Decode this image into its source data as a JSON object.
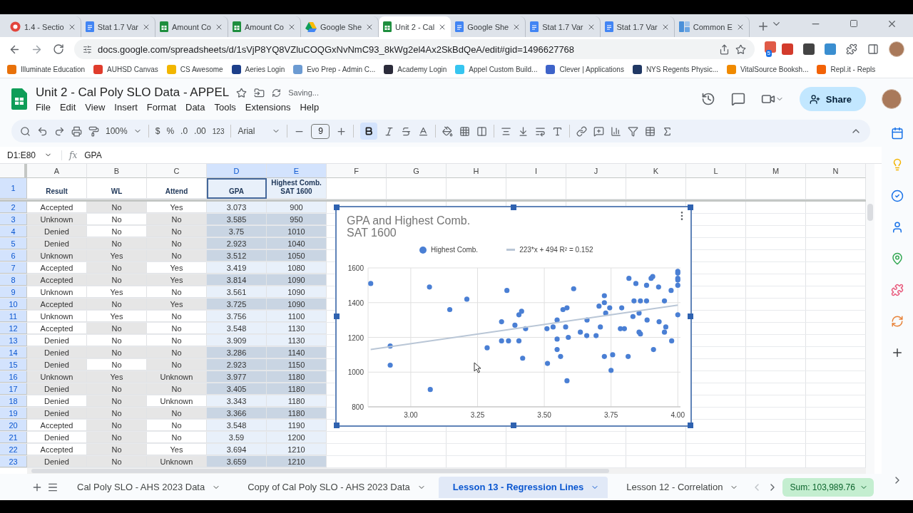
{
  "browser": {
    "tabs": [
      {
        "label": "1.4 - Sectio",
        "kind": "section",
        "selected": false
      },
      {
        "label": "Stat 1.7 Var",
        "kind": "docs",
        "selected": false
      },
      {
        "label": "Amount Co",
        "kind": "sheets",
        "selected": false
      },
      {
        "label": "Amount Co",
        "kind": "sheets",
        "selected": false
      },
      {
        "label": "Google She",
        "kind": "drive",
        "selected": false
      },
      {
        "label": "Unit 2 - Cal",
        "kind": "sheets",
        "selected": true
      },
      {
        "label": "Google She",
        "kind": "docs",
        "selected": false
      },
      {
        "label": "Stat 1.7 Var",
        "kind": "docs",
        "selected": false
      },
      {
        "label": "Stat 1.7 Var",
        "kind": "docs",
        "selected": false
      },
      {
        "label": "Common E",
        "kind": "app",
        "selected": false
      }
    ],
    "url": "docs.google.com/spreadsheets/d/1sVjP8YQ8VZluCOQGxNvNmC93_8kWg2el4Ax2SkBdQeA/edit#gid=1496627768",
    "extension_badge": "5"
  },
  "bookmarks": [
    {
      "label": "Illuminate Education",
      "color": "#e8710a"
    },
    {
      "label": "AUHSD Canvas",
      "color": "#e03c2c"
    },
    {
      "label": "CS Awesome",
      "color": "#f2b600"
    },
    {
      "label": "Aeries Login",
      "color": "#1d3f8a"
    },
    {
      "label": "Evo Prep - Admin C...",
      "color": "#6c9bd2"
    },
    {
      "label": "Academy Login",
      "color": "#2b2b3a"
    },
    {
      "label": "Appel Custom Build...",
      "color": "#36c5f0"
    },
    {
      "label": "Clever | Applications",
      "color": "#3e63c9"
    },
    {
      "label": "NYS Regents Physic...",
      "color": "#203864"
    },
    {
      "label": "VitalSource Booksh...",
      "color": "#f08a00"
    },
    {
      "label": "Repl.it - Repls",
      "color": "#f26207"
    }
  ],
  "document": {
    "title": "Unit 2 - Cal Poly SLO Data - APPEL",
    "status": "Saving...",
    "menu": [
      "File",
      "Edit",
      "View",
      "Insert",
      "Format",
      "Data",
      "Tools",
      "Extensions",
      "Help"
    ],
    "share": "Share"
  },
  "toolbar": {
    "zoom": "100%",
    "currency": "$",
    "percent": "%",
    "decrease_decimal": ".0",
    "increase_decimal": ".00",
    "number_format": "123",
    "font": "Arial",
    "font_size": "9",
    "bold_on": true
  },
  "formula_bar": {
    "name_box": "D1:E80",
    "fx": "fx",
    "formula": "GPA"
  },
  "sheet": {
    "columns": [
      {
        "label": "A",
        "selected": false
      },
      {
        "label": "B",
        "selected": false
      },
      {
        "label": "C",
        "selected": false
      },
      {
        "label": "D",
        "selected": true
      },
      {
        "label": "E",
        "selected": true
      },
      {
        "label": "F",
        "selected": false
      },
      {
        "label": "G",
        "selected": false
      },
      {
        "label": "H",
        "selected": false
      },
      {
        "label": "I",
        "selected": false
      },
      {
        "label": "J",
        "selected": false
      },
      {
        "label": "K",
        "selected": false
      },
      {
        "label": "L",
        "selected": false
      },
      {
        "label": "M",
        "selected": false
      },
      {
        "label": "N",
        "selected": false
      }
    ],
    "rows": [
      {
        "number": "1",
        "selected": true,
        "cells": [
          {
            "text": "Result",
            "shaded": false,
            "active": false
          },
          {
            "text": "WL",
            "shaded": false,
            "active": false
          },
          {
            "text": "Attend",
            "shaded": false,
            "active": false
          },
          {
            "text": "GPA",
            "shaded": false,
            "active": true
          },
          {
            "text": "Highest Comb. SAT 1600",
            "shaded": false,
            "active": false
          }
        ]
      },
      {
        "number": "2",
        "selected": true,
        "cells": [
          {
            "text": "Accepted",
            "shaded": false
          },
          {
            "text": "No",
            "shaded": true
          },
          {
            "text": "Yes",
            "shaded": false
          },
          {
            "text": "3.073",
            "shaded": false
          },
          {
            "text": "900",
            "shaded": false
          }
        ]
      },
      {
        "number": "3",
        "selected": true,
        "cells": [
          {
            "text": "Unknown",
            "shaded": true
          },
          {
            "text": "No",
            "shaded": false
          },
          {
            "text": "No",
            "shaded": true
          },
          {
            "text": "3.585",
            "shaded": true
          },
          {
            "text": "950",
            "shaded": true
          }
        ]
      },
      {
        "number": "4",
        "selected": true,
        "cells": [
          {
            "text": "Denied",
            "shaded": true
          },
          {
            "text": "No",
            "shaded": false
          },
          {
            "text": "No",
            "shaded": true
          },
          {
            "text": "3.75",
            "shaded": true
          },
          {
            "text": "1010",
            "shaded": true
          }
        ]
      },
      {
        "number": "5",
        "selected": true,
        "cells": [
          {
            "text": "Denied",
            "shaded": true
          },
          {
            "text": "No",
            "shaded": true
          },
          {
            "text": "No",
            "shaded": true
          },
          {
            "text": "2.923",
            "shaded": true
          },
          {
            "text": "1040",
            "shaded": true
          }
        ]
      },
      {
        "number": "6",
        "selected": true,
        "cells": [
          {
            "text": "Unknown",
            "shaded": true
          },
          {
            "text": "Yes",
            "shaded": true
          },
          {
            "text": "No",
            "shaded": true
          },
          {
            "text": "3.512",
            "shaded": true
          },
          {
            "text": "1050",
            "shaded": true
          }
        ]
      },
      {
        "number": "7",
        "selected": true,
        "cells": [
          {
            "text": "Accepted",
            "shaded": false
          },
          {
            "text": "No",
            "shaded": true
          },
          {
            "text": "Yes",
            "shaded": false
          },
          {
            "text": "3.419",
            "shaded": false
          },
          {
            "text": "1080",
            "shaded": false
          }
        ]
      },
      {
        "number": "8",
        "selected": true,
        "cells": [
          {
            "text": "Accepted",
            "shaded": true
          },
          {
            "text": "No",
            "shaded": true
          },
          {
            "text": "Yes",
            "shaded": true
          },
          {
            "text": "3.814",
            "shaded": true
          },
          {
            "text": "1090",
            "shaded": true
          }
        ]
      },
      {
        "number": "9",
        "selected": true,
        "cells": [
          {
            "text": "Unknown",
            "shaded": false
          },
          {
            "text": "Yes",
            "shaded": false
          },
          {
            "text": "No",
            "shaded": false
          },
          {
            "text": "3.561",
            "shaded": false
          },
          {
            "text": "1090",
            "shaded": false
          }
        ]
      },
      {
        "number": "10",
        "selected": true,
        "cells": [
          {
            "text": "Accepted",
            "shaded": true
          },
          {
            "text": "No",
            "shaded": true
          },
          {
            "text": "Yes",
            "shaded": true
          },
          {
            "text": "3.725",
            "shaded": true
          },
          {
            "text": "1090",
            "shaded": true
          }
        ]
      },
      {
        "number": "11",
        "selected": true,
        "cells": [
          {
            "text": "Unknown",
            "shaded": false
          },
          {
            "text": "Yes",
            "shaded": false
          },
          {
            "text": "No",
            "shaded": false
          },
          {
            "text": "3.756",
            "shaded": false
          },
          {
            "text": "1100",
            "shaded": false
          }
        ]
      },
      {
        "number": "12",
        "selected": true,
        "cells": [
          {
            "text": "Accepted",
            "shaded": false
          },
          {
            "text": "No",
            "shaded": true
          },
          {
            "text": "No",
            "shaded": false
          },
          {
            "text": "3.548",
            "shaded": false
          },
          {
            "text": "1130",
            "shaded": false
          }
        ]
      },
      {
        "number": "13",
        "selected": true,
        "cells": [
          {
            "text": "Denied",
            "shaded": false
          },
          {
            "text": "No",
            "shaded": false
          },
          {
            "text": "No",
            "shaded": false
          },
          {
            "text": "3.909",
            "shaded": false
          },
          {
            "text": "1130",
            "shaded": false
          }
        ]
      },
      {
        "number": "14",
        "selected": true,
        "cells": [
          {
            "text": "Denied",
            "shaded": true
          },
          {
            "text": "No",
            "shaded": true
          },
          {
            "text": "No",
            "shaded": true
          },
          {
            "text": "3.286",
            "shaded": true
          },
          {
            "text": "1140",
            "shaded": true
          }
        ]
      },
      {
        "number": "15",
        "selected": true,
        "cells": [
          {
            "text": "Denied",
            "shaded": true
          },
          {
            "text": "No",
            "shaded": false
          },
          {
            "text": "No",
            "shaded": true
          },
          {
            "text": "2.923",
            "shaded": true
          },
          {
            "text": "1150",
            "shaded": true
          }
        ]
      },
      {
        "number": "16",
        "selected": true,
        "cells": [
          {
            "text": "Unknown",
            "shaded": true
          },
          {
            "text": "Yes",
            "shaded": true
          },
          {
            "text": "Unknown",
            "shaded": true
          },
          {
            "text": "3.977",
            "shaded": true
          },
          {
            "text": "1180",
            "shaded": true
          }
        ]
      },
      {
        "number": "17",
        "selected": true,
        "cells": [
          {
            "text": "Denied",
            "shaded": true
          },
          {
            "text": "No",
            "shaded": true
          },
          {
            "text": "No",
            "shaded": true
          },
          {
            "text": "3.405",
            "shaded": true
          },
          {
            "text": "1180",
            "shaded": true
          }
        ]
      },
      {
        "number": "18",
        "selected": true,
        "cells": [
          {
            "text": "Denied",
            "shaded": false
          },
          {
            "text": "No",
            "shaded": true
          },
          {
            "text": "Unknown",
            "shaded": false
          },
          {
            "text": "3.343",
            "shaded": false
          },
          {
            "text": "1180",
            "shaded": false
          }
        ]
      },
      {
        "number": "19",
        "selected": true,
        "cells": [
          {
            "text": "Denied",
            "shaded": true
          },
          {
            "text": "No",
            "shaded": true
          },
          {
            "text": "No",
            "shaded": true
          },
          {
            "text": "3.366",
            "shaded": true
          },
          {
            "text": "1180",
            "shaded": true
          }
        ]
      },
      {
        "number": "20",
        "selected": true,
        "cells": [
          {
            "text": "Accepted",
            "shaded": false
          },
          {
            "text": "No",
            "shaded": true
          },
          {
            "text": "No",
            "shaded": false
          },
          {
            "text": "3.548",
            "shaded": false
          },
          {
            "text": "1190",
            "shaded": false
          }
        ]
      },
      {
        "number": "21",
        "selected": true,
        "cells": [
          {
            "text": "Denied",
            "shaded": false
          },
          {
            "text": "No",
            "shaded": true
          },
          {
            "text": "No",
            "shaded": false
          },
          {
            "text": "3.59",
            "shaded": false
          },
          {
            "text": "1200",
            "shaded": false
          }
        ]
      },
      {
        "number": "22",
        "selected": true,
        "cells": [
          {
            "text": "Accepted",
            "shaded": false
          },
          {
            "text": "No",
            "shaded": true
          },
          {
            "text": "Yes",
            "shaded": false
          },
          {
            "text": "3.694",
            "shaded": false
          },
          {
            "text": "1210",
            "shaded": false
          }
        ]
      },
      {
        "number": "23",
        "selected": true,
        "cells": [
          {
            "text": "Denied",
            "shaded": true
          },
          {
            "text": "No",
            "shaded": true
          },
          {
            "text": "Unknown",
            "shaded": true
          },
          {
            "text": "3.659",
            "shaded": true
          },
          {
            "text": "1210",
            "shaded": true
          }
        ]
      }
    ],
    "chart": {
      "chart_data": {
        "type": "scatter",
        "title": "GPA and Highest Comb. SAT 1600",
        "x": [
          2.85,
          2.923,
          2.923,
          3.07,
          3.073,
          3.146,
          3.21,
          3.286,
          3.34,
          3.34,
          3.36,
          3.366,
          3.39,
          3.405,
          3.405,
          3.415,
          3.419,
          3.43,
          3.51,
          3.512,
          3.533,
          3.548,
          3.548,
          3.548,
          3.561,
          3.57,
          3.58,
          3.585,
          3.585,
          3.59,
          3.61,
          3.635,
          3.66,
          3.659,
          3.694,
          3.705,
          3.71,
          3.725,
          3.725,
          3.725,
          3.73,
          3.745,
          3.75,
          3.756,
          3.785,
          3.79,
          3.8,
          3.814,
          3.817,
          3.832,
          3.836,
          3.843,
          3.855,
          3.855,
          3.86,
          3.86,
          3.883,
          3.883,
          3.885,
          3.9,
          3.906,
          3.909,
          3.928,
          3.93,
          3.95,
          3.95,
          3.955,
          3.975,
          3.977,
          4.0,
          4.0,
          4.0,
          4.0,
          4.0,
          4.0
        ],
        "series": [
          {
            "name": "Highest Comb.",
            "color": "#4a7fd4",
            "values": [
              1510,
              1150,
              1040,
              1490,
              900,
              1360,
              1420,
              1140,
              1290,
              1180,
              1470,
              1180,
              1270,
              1180,
              1330,
              1350,
              1080,
              1250,
              1250,
              1050,
              1260,
              1300,
              1190,
              1130,
              1090,
              1360,
              1260,
              1370,
              950,
              1200,
              1480,
              1230,
              1300,
              1210,
              1210,
              1380,
              1260,
              1440,
              1400,
              1090,
              1340,
              1370,
              1010,
              1100,
              1250,
              1370,
              1250,
              1090,
              1540,
              1320,
              1410,
              1510,
              1340,
              1230,
              1220,
              1410,
              1410,
              1500,
              1300,
              1540,
              1550,
              1130,
              1490,
              1290,
              1410,
              1230,
              1260,
              1470,
              1180,
              1580,
              1570,
              1540,
              1530,
              1500,
              1330
            ]
          },
          {
            "name": "223*x + 494 R² = 0.152",
            "type": "line",
            "color": "#b9c6d6",
            "values": [
              1130,
              null,
              null,
              null,
              null,
              null,
              null,
              null,
              null,
              null,
              null,
              null,
              null,
              null,
              null,
              null,
              null,
              null,
              null,
              null,
              null,
              null,
              null,
              null,
              null,
              null,
              null,
              null,
              null,
              null,
              null,
              null,
              null,
              null,
              null,
              null,
              null,
              null,
              null,
              null,
              null,
              null,
              null,
              null,
              null,
              null,
              null,
              null,
              null,
              null,
              null,
              null,
              null,
              null,
              null,
              null,
              null,
              null,
              null,
              null,
              null,
              null,
              null,
              null,
              null,
              null,
              null,
              null,
              null,
              null,
              null,
              null,
              null,
              null,
              1386
            ]
          }
        ],
        "xlim": [
          2.84,
          4.01
        ],
        "ylim": [
          800,
          1600
        ],
        "grid": true,
        "legend": true,
        "xticks": [
          {
            "value": 3,
            "label": "3.00"
          },
          {
            "value": 3.25,
            "label": "3.25"
          },
          {
            "value": 3.5,
            "label": "3.50"
          },
          {
            "value": 3.75,
            "label": "3.75"
          },
          {
            "value": 4,
            "label": "4.00"
          }
        ],
        "yticks": [
          {
            "value": 800,
            "label": "800"
          },
          {
            "value": 1000,
            "label": "1000"
          },
          {
            "value": 1200,
            "label": "1200"
          },
          {
            "value": 1400,
            "label": "1400"
          },
          {
            "value": 1600,
            "label": "1600"
          }
        ]
      }
    }
  },
  "sheet_tabs": [
    {
      "label": "Cal Poly SLO - AHS 2023 Data",
      "selected": false
    },
    {
      "label": "Copy of Cal Poly SLO - AHS 2023 Data",
      "selected": false
    },
    {
      "label": "Lesson 13 - Regression Lines",
      "selected": true
    },
    {
      "label": "Lesson 12 - Correlation",
      "selected": false
    }
  ],
  "sum": "Sum: 103,989.76"
}
